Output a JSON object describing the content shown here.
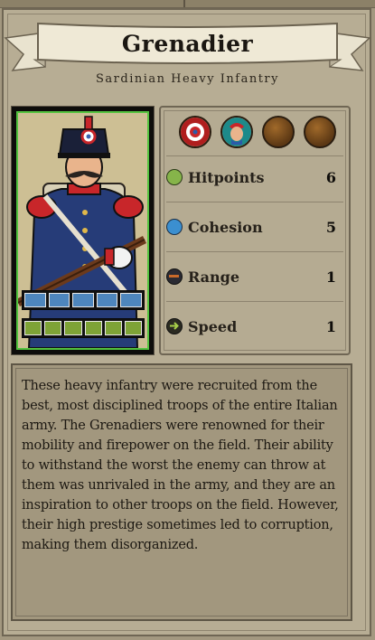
{
  "unit": {
    "name": "Grenadier",
    "subtitle": "Sardinian Heavy Infantry",
    "portrait_icon": "grenadier-portrait",
    "selection_color": "#53c33f"
  },
  "bars": {
    "cohesion_pips": 5,
    "hitpoint_pips": 6,
    "cohesion_color": "#4e86bd",
    "hitpoint_color": "#7ea336"
  },
  "traits": [
    {
      "name": "target-cockade-icon",
      "filled": true
    },
    {
      "name": "face-portrait-icon",
      "filled": true
    },
    {
      "name": "empty-trait-slot",
      "filled": false
    },
    {
      "name": "empty-trait-slot",
      "filled": false
    }
  ],
  "stats": {
    "hitpoints": {
      "label": "Hitpoints",
      "value": "6",
      "icon": "hitpoints-icon",
      "color": "#86b44a"
    },
    "cohesion": {
      "label": "Cohesion",
      "value": "5",
      "icon": "cohesion-icon",
      "color": "#3b8fd0"
    },
    "range": {
      "label": "Range",
      "value": "1",
      "icon": "range-icon"
    },
    "speed": {
      "label": "Speed",
      "value": "1",
      "icon": "speed-icon"
    }
  },
  "description": "These heavy infantry were recruited from the best, most disciplined troops of the entire Italian army. The Grenadiers were renowned for their mobility and firepower on the field. Their ability to withstand the worst the enemy can throw at them was unrivaled in the army, and they are an inspiration to other troops on the field. However, their high prestige sometimes led to corruption, making them disorganized."
}
